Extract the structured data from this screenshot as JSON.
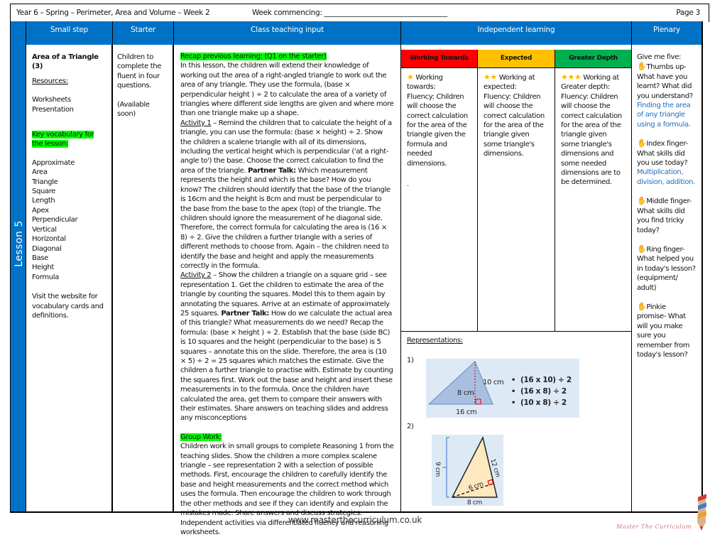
{
  "header": {
    "title": "Year 6 – Spring – Perimeter, Area and Volume – Week 2",
    "week_commencing": "Week commencing: ___________________________________",
    "page": "Page 3"
  },
  "columns": {
    "small_step": "Small step",
    "starter": "Starter",
    "teaching": "Class teaching input",
    "independent": "Independent learning",
    "plenary": "Plenary"
  },
  "lesson_label": "Lesson 5",
  "small_step": {
    "title": "Area of a Triangle (3)",
    "resources_label": "Resources:",
    "resources": [
      "Worksheets",
      "Presentation"
    ],
    "vocab_label": "Key vocabulary for the lesson:",
    "vocabulary": [
      "Approximate",
      "Area",
      "Triangle",
      "Square",
      "Length",
      "Apex",
      "Perpendicular",
      "Vertical",
      "Horizontal",
      "Diagonal",
      "Base",
      "Height",
      "Formula"
    ],
    "website_note": "Visit the website for vocabulary cards and definitions."
  },
  "starter": {
    "text": "Children to complete the fluent in four questions.",
    "note": "(Available soon)"
  },
  "teaching": {
    "recap_label": "Recap previous learning: (Q1 on the starter)",
    "intro": "In this lesson, the children will extend their knowledge of working out the area of a right-angled triangle to work out the area of any triangle. They use the formula, (base × perpendicular height ) ÷ 2 to calculate the area of a variety of triangles where different side lengths are given and where more than one triangle make up a shape.",
    "activity1_label": "Activity 1",
    "activity1_a": " – Remind the children that to calculate the height of a triangle, you can use the formula: (base × height) ÷ 2. Show the children a scalene triangle with all of its dimensions, including the vertical height which is perpendicular ('at a right-angle to') the base. Choose the correct calculation to find the area of the triangle. ",
    "partner_talk": "Partner Talk:",
    "activity1_b": " Which measurement represents the height and which is the base? How do you know? The children should identify that the base of the triangle is 16cm and the height is 8cm and must be perpendicular to the base from the base to the apex (top) of the triangle. The children should ignore the measurement of he diagonal side. Therefore, the correct formula for calculating the area is (16 × 8) ÷ 2. Give the children a further triangle with a series of different methods to choose from. Again – the children need to identify the base and height and apply the measurements correctly in the formula.",
    "activity2_label": "Activity 2",
    "activity2_a": " – Show the children a triangle on a square grid – see representation 1. Get the children to estimate the area of the triangle by counting the squares. Model this to them again by annotating the squares. Arrive at an estimate of approximately 25 squares. ",
    "activity2_b": " How do we calculate the actual area of this triangle? What measurements do we need? Recap the formula: (base × height ) ÷ 2. Establish that the base (side BC) is 10 squares and the height (perpendicular to the base) is 5 squares – annotate this on the slide. Therefore, the area is (10 × 5) ÷ 2 = 25 squares which matches the estimate. Give the children a further triangle to practise with. Estimate by counting the squares first. Work out the base and height and insert these measurements in to the formula. Once the children have calculated the area, get them to compare their answers with their estimates. Share answers on teaching slides and address any misconceptions",
    "group_work_label": "Group Work:",
    "group_work": "Children work in small groups to complete Reasoning 1 from the teaching slides. Show the children a more complex scalene triangle – see representation 2 with a selection of possible methods. First, encourage the children to carefully identify the base and height measurements and the correct method which uses the formula. Then encourage the children to work through the other methods and see if they can identify and explain the mistakes made. Share answers and discuss strategies. Independent activities via differentiated fluency and reasoning worksheets."
  },
  "independent": {
    "levels": [
      {
        "label": "Working Towards",
        "color": "#ff0000",
        "stars": "★",
        "heading": " Working towards:",
        "text": "Fluency:  Children will choose the correct calculation for the area of the triangle given the formula and needed dimensions.",
        "extra": "."
      },
      {
        "label": "Expected",
        "color": "#ffc000",
        "stars": "★★",
        "heading": " Working at expected:",
        "text": "Fluency:  Children will choose the correct calculation for the area of the triangle given some triangle's dimensions.",
        "extra": ""
      },
      {
        "label": "Greater Depth",
        "color": "#00b050",
        "stars": "★★★",
        "heading": " Working at Greater depth:",
        "text": "Fluency: Children will choose the correct calculation for the area of the triangle given some triangle's dimensions and some needed dimensions are to be determined.",
        "extra": ""
      }
    ],
    "representations_label": "Representations:",
    "rep1": {
      "number": "1)",
      "labels": {
        "height": "8 cm",
        "side": "10 cm",
        "base": "16 cm"
      },
      "options": [
        "(16 x 10) ÷ 2",
        "(16 x 8) ÷ 2",
        "(10 x 8) ÷ 2"
      ]
    },
    "rep2": {
      "number": "2)",
      "labels": {
        "height": "9 cm",
        "side": "12 cm",
        "perp": "6 cm",
        "base": "8 cm"
      }
    }
  },
  "plenary": {
    "intro": "Give me five:",
    "items": [
      {
        "finger": "Thumbs up-",
        "question": "What have you learnt? What did you understand?",
        "answer": "Finding the area of any triangle using a formula."
      },
      {
        "finger": "Index finger-",
        "question": "What skills did you use today?",
        "answer": "Multiplication, division, addition."
      },
      {
        "finger": "Middle finger-",
        "question": "What skills did you find tricky today?",
        "answer": ""
      },
      {
        "finger": "Ring finger-",
        "question": "What helped you in today's lesson? (equipment/ adult)",
        "answer": ""
      },
      {
        "finger": "Pinkie promise-",
        "question": "What will you make sure you remember from today's lesson?",
        "answer": ""
      }
    ]
  },
  "footer": {
    "website": "www.masterthecurriculum.co.uk",
    "brand": "Master The Curriculum"
  }
}
